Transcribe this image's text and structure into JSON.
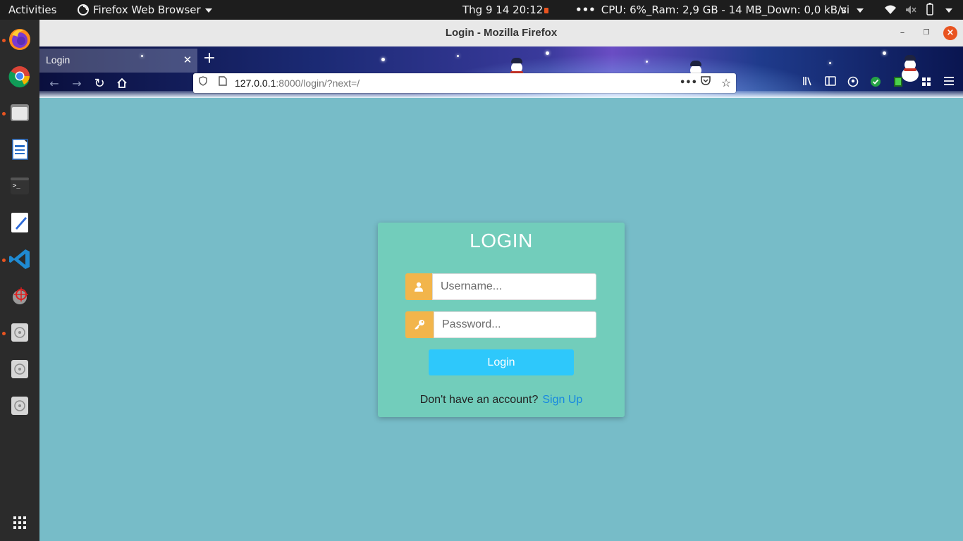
{
  "system_bar": {
    "activities": "Activities",
    "app_menu": "Firefox Web Browser",
    "clock": "Thg 9 14  20:12",
    "stats": "CPU: 6%_Ram: 2,9 GB - 14 MB_Down: 0,0 kB/s",
    "language": "vi"
  },
  "dock": {
    "apps": [
      "firefox-icon",
      "chrome-icon",
      "files-icon",
      "writer-icon",
      "terminal-icon",
      "text-editor-icon",
      "vscode-icon",
      "screenshot-tool-icon",
      "disk-icon",
      "disk-icon",
      "disk-icon"
    ],
    "show_apps": "show-applications-icon"
  },
  "window": {
    "title": "Login - Mozilla Firefox"
  },
  "browser": {
    "tab_label": "Login",
    "url_host": "127.0.0.1",
    "url_rest": ":8000/login/?next=/"
  },
  "login": {
    "title": "LOGIN",
    "username_placeholder": "Username...",
    "password_placeholder": "Password...",
    "submit_label": "Login",
    "no_account_text": "Don't have an account?",
    "signup_label": "Sign Up"
  },
  "colors": {
    "page_background": "#77bcc8",
    "card_background": "#72cdbb",
    "icon_addon": "#f2b54b",
    "button": "#2ec8fb",
    "link": "#1888e0"
  }
}
